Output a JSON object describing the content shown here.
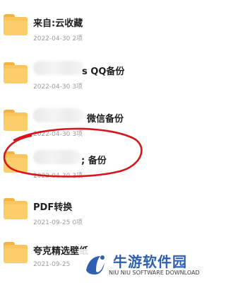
{
  "folders": [
    {
      "name": "来自:云收藏",
      "date": "2022-04-30",
      "count": "2项"
    },
    {
      "name": "s QQ备份",
      "date": "2022-04-30",
      "count": "3项"
    },
    {
      "name": "微信备份",
      "date": "2022-04-30",
      "count": "3项"
    },
    {
      "name": "; 备份",
      "date": "2022-04-30",
      "count": "3项"
    },
    {
      "name": "PDF转换",
      "date": "2021-09-25",
      "count": "0项"
    },
    {
      "name": "夸克精选壁纸",
      "date": "2021-09-25",
      "count": ""
    }
  ],
  "watermark": {
    "title": "牛游软件园",
    "subtitle": "NIU NIU SOFTWARE DOWNLOAD"
  },
  "colors": {
    "folder": "#f9c55c",
    "annotation": "#d9141b",
    "watermark_blue": "#2f5fb3"
  }
}
